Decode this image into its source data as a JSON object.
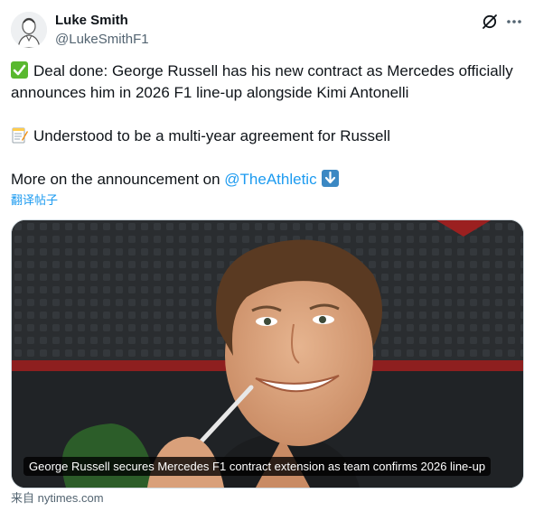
{
  "author": {
    "name": "Luke Smith",
    "handle": "@LukeSmithF1"
  },
  "tweet": {
    "line1_prefix_icon": "check-mark-emoji",
    "line1": "Deal done: George Russell has his new contract as Mercedes officially announces him in 2026 F1 line-up alongside Kimi Antonelli",
    "line2_prefix_icon": "memo-emoji",
    "line2": "Understood to be a multi-year agreement for Russell",
    "line3_text": "More on the announcement on ",
    "line3_mention": "@TheAthletic",
    "line3_suffix_icon": "down-arrow-emoji"
  },
  "translate_label": "翻译帖子",
  "media": {
    "caption": "George Russell secures Mercedes F1 contract extension as team confirms 2026 line-up"
  },
  "source": {
    "prefix": "来自 ",
    "domain": "nytimes.com"
  },
  "colors": {
    "link": "#1d9bf0",
    "secondary_text": "#536471",
    "primary_text": "#0f1419"
  }
}
